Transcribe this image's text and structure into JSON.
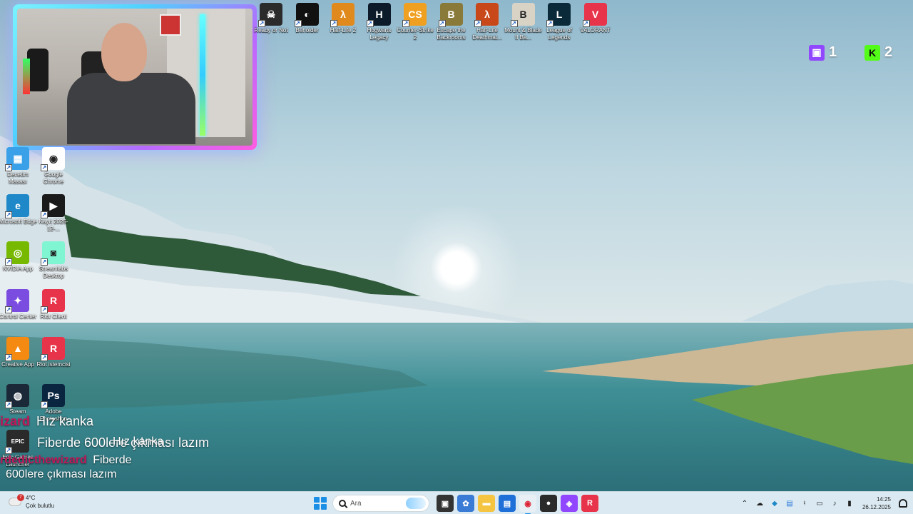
{
  "desktop": {
    "top_icons": [
      {
        "label": "Ready or Not",
        "color": "#2b2b2b",
        "icon": "ready-or-not-icon",
        "glyph": "☠"
      },
      {
        "label": "Beholder",
        "color": "#111111",
        "icon": "beholder-icon",
        "glyph": "◐"
      },
      {
        "label": "Half-Life 2",
        "color": "#e08a1e",
        "icon": "half-life-2-icon",
        "glyph": "λ"
      },
      {
        "label": "Hogwarts Legacy",
        "color": "#0c1a2a",
        "icon": "hogwarts-legacy-icon",
        "glyph": "H"
      },
      {
        "label": "Counter-Strike 2",
        "color": "#f0a020",
        "icon": "counter-strike-icon",
        "glyph": "CS"
      },
      {
        "label": "Escape the Backrooms",
        "color": "#8a7a3a",
        "icon": "escape-backrooms-icon",
        "glyph": "B"
      },
      {
        "label": "Half-Life Deathmat...",
        "color": "#c8481a",
        "icon": "half-life-deathmatch-icon",
        "glyph": "λ"
      },
      {
        "label": "Mount & Blade II Ba...",
        "color": "#d9d3c6",
        "icon": "mount-blade-icon",
        "glyph": "B"
      },
      {
        "label": "League of Legends",
        "color": "#0a2a3a",
        "icon": "league-of-legends-icon",
        "glyph": "L"
      },
      {
        "label": "VALORANT",
        "color": "#e8344a",
        "icon": "valorant-icon",
        "glyph": "V"
      }
    ],
    "left_icons": [
      {
        "label": "Denetim Masası",
        "color": "#3aa0e8",
        "icon": "control-panel-icon",
        "glyph": "▦"
      },
      {
        "label": "Google Chrome",
        "color": "#ffffff",
        "icon": "chrome-icon",
        "glyph": "◉"
      },
      {
        "label": "Microsoft Edge",
        "color": "#1e88c8",
        "icon": "edge-icon",
        "glyph": "e"
      },
      {
        "label": "Kayıt 2025-12-...",
        "color": "#1a1a1a",
        "icon": "video-file-icon",
        "glyph": "▶"
      },
      {
        "label": "NVIDIA App",
        "color": "#76b900",
        "icon": "nvidia-icon",
        "glyph": "◎"
      },
      {
        "label": "Streamlabs Desktop",
        "color": "#80f5d2",
        "icon": "streamlabs-icon",
        "glyph": "◙"
      },
      {
        "label": "Control Center",
        "color": "#7a4ce0",
        "icon": "control-center-icon",
        "glyph": "✦"
      },
      {
        "label": "Riot Client",
        "color": "#e8344a",
        "icon": "riot-client-icon",
        "glyph": "R"
      },
      {
        "label": "Creative App",
        "color": "#f48a12",
        "icon": "creative-app-icon",
        "glyph": "▲"
      },
      {
        "label": "Riot istemcisi",
        "color": "#e8344a",
        "icon": "riot-istemcisi-icon",
        "glyph": "R"
      },
      {
        "label": "Steam",
        "color": "#1b2838",
        "icon": "steam-icon",
        "glyph": "◍"
      },
      {
        "label": "Adobe Photoshop",
        "color": "#0a2540",
        "icon": "photoshop-icon",
        "glyph": "Ps"
      },
      {
        "label": "Epic Games Launcher",
        "color": "#2a2a2a",
        "icon": "epic-games-icon",
        "glyph": "EPIC"
      }
    ]
  },
  "counters": [
    {
      "icon": "twitch-icon",
      "color": "#9146ff",
      "glyph": "▣",
      "value": "1"
    },
    {
      "icon": "kick-icon",
      "color": "#53fc18",
      "glyph": "K",
      "value": "2"
    }
  ],
  "chat": [
    {
      "user": "izard",
      "message": "Hız kanka"
    },
    {
      "user": "",
      "message": "Fiberde 600lere çıkması lazım"
    },
    {
      "user": "",
      "message": "Hız kanka"
    },
    {
      "user": "rdedicthewizard",
      "message": "Fiberde"
    },
    {
      "user": "",
      "message": "600lere çıkması lazım"
    }
  ],
  "taskbar": {
    "weather": {
      "temp": "4°C",
      "condition": "Çok bulutlu",
      "alert": "7"
    },
    "search_placeholder": "Ara",
    "apps": [
      {
        "icon": "task-view-icon",
        "color": "#333333",
        "glyph": "▣"
      },
      {
        "icon": "copilot-icon",
        "color": "#3a7bd5",
        "glyph": "✿"
      },
      {
        "icon": "file-explorer-icon",
        "color": "#f5c542",
        "glyph": "▬"
      },
      {
        "icon": "store-icon",
        "color": "#1e6fd8",
        "glyph": "▤"
      },
      {
        "icon": "chrome-taskbar-icon",
        "color": "#e8f0f5",
        "glyph": "◉"
      },
      {
        "icon": "obs-icon",
        "color": "#2a2a2a",
        "glyph": "●"
      },
      {
        "icon": "twitch-taskbar-icon",
        "color": "#9146ff",
        "glyph": "◈"
      },
      {
        "icon": "riot-taskbar-icon",
        "color": "#e8344a",
        "glyph": "R"
      }
    ],
    "time": "14:25",
    "date": "26.12.2025"
  }
}
